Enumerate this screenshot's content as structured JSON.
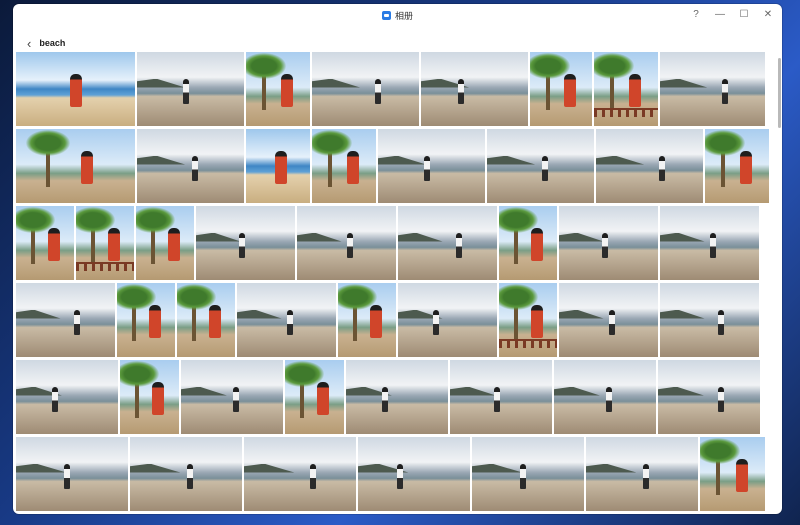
{
  "window": {
    "title": "相册",
    "controls": [
      "?",
      "—",
      "☐",
      "✕"
    ]
  },
  "nav": {
    "back_glyph": "‹",
    "album_title": "beach"
  },
  "photos": {
    "rows": [
      [
        "blue",
        "gray",
        "palm",
        "gray",
        "gray",
        "palm",
        "palm",
        "gray"
      ],
      [
        "palm",
        "gray",
        "blue",
        "palm",
        "gray",
        "gray",
        "gray",
        "palm"
      ],
      [
        "palm",
        "palm",
        "palm",
        "gray",
        "gray",
        "gray",
        "palm",
        "gray",
        "gray"
      ],
      [
        "gray",
        "palm",
        "palm",
        "gray",
        "palm",
        "gray",
        "palm",
        "gray",
        "gray"
      ],
      [
        "gray",
        "palm",
        "gray",
        "palm",
        "gray",
        "gray",
        "gray",
        "gray"
      ],
      [
        "gray",
        "gray",
        "gray",
        "gray",
        "gray",
        "gray",
        "palm"
      ]
    ]
  }
}
